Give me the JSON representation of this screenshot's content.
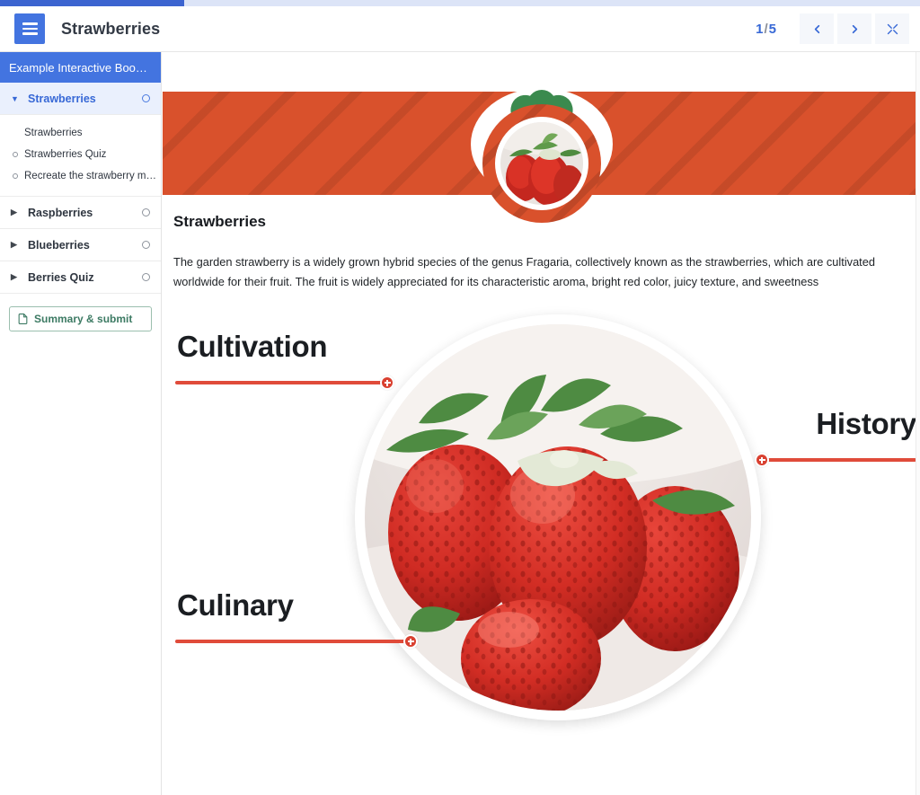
{
  "progress": {
    "current_page": 1,
    "total_pages": 5,
    "percent": 20
  },
  "header": {
    "title": "Strawberries",
    "menu_icon": "hamburger-icon",
    "page_indicator_current": "1",
    "page_indicator_separator": "/",
    "page_indicator_total": "5",
    "prev_icon": "chevron-left-icon",
    "next_icon": "chevron-right-icon",
    "fullscreen_icon": "expand-icon"
  },
  "sidebar": {
    "book_title": "Example Interactive Boo…",
    "chapters": [
      {
        "label": "Strawberries",
        "expanded": true,
        "active": true,
        "caret": "▼"
      },
      {
        "label": "Raspberries",
        "expanded": false,
        "active": false,
        "caret": "▶"
      },
      {
        "label": "Blueberries",
        "expanded": false,
        "active": false,
        "caret": "▶"
      },
      {
        "label": "Berries Quiz",
        "expanded": false,
        "active": false,
        "caret": "▶"
      }
    ],
    "sub_items": [
      {
        "label": "Strawberries",
        "has_dot": false
      },
      {
        "label": "Strawberries Quiz",
        "has_dot": true
      },
      {
        "label": "Recreate the strawberry m…",
        "has_dot": true
      }
    ],
    "summary_button": {
      "label": "Summary & submit",
      "icon": "document-icon"
    }
  },
  "main": {
    "banner": {
      "badge_icon": "strawberry-badge",
      "accent_color": "#d9512c"
    },
    "article_title": "Strawberries",
    "article_body": "The garden strawberry is a widely grown hybrid species of the genus Fragaria, collectively known as the strawberries, which are cultivated worldwide for their fruit. The fruit is widely appreciated for its characteristic aroma, bright red color, juicy texture, and sweetness",
    "hotspots": [
      {
        "label": "Cultivation",
        "position": "top-left",
        "marker_icon": "plus-marker-icon"
      },
      {
        "label": "History",
        "position": "right",
        "marker_icon": "plus-marker-icon"
      },
      {
        "label": "Culinary",
        "position": "bottom-left",
        "marker_icon": "plus-marker-icon"
      }
    ],
    "center_image_alt": "strawberries-photo"
  },
  "colors": {
    "primary_blue": "#4374e0",
    "accent_orange": "#d9512c",
    "marker_red": "#d94030",
    "summary_green": "#3c7a63"
  }
}
